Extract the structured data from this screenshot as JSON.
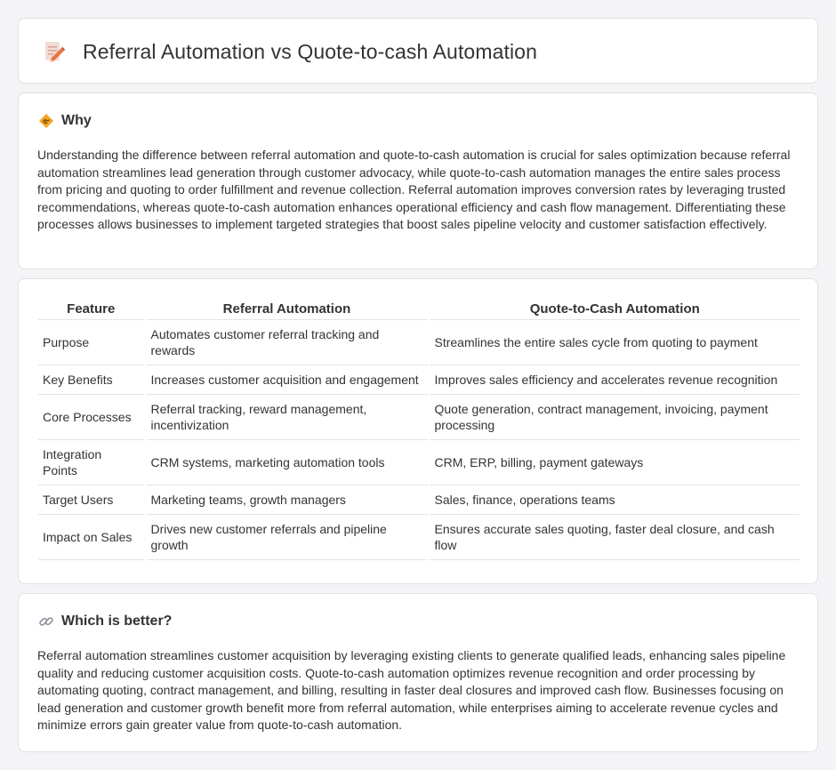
{
  "header": {
    "title": "Referral Automation vs Quote-to-cash Automation",
    "icon": "edit-document-icon"
  },
  "why": {
    "title": "Why",
    "icon": "handshake-diamond-icon",
    "text": "Understanding the difference between referral automation and quote-to-cash automation is crucial for sales optimization because referral automation streamlines lead generation through customer advocacy, while quote-to-cash automation manages the entire sales process from pricing and quoting to order fulfillment and revenue collection. Referral automation improves conversion rates by leveraging trusted recommendations, whereas quote-to-cash automation enhances operational efficiency and cash flow management. Differentiating these processes allows businesses to implement targeted strategies that boost sales pipeline velocity and customer satisfaction effectively."
  },
  "table": {
    "headers": [
      "Feature",
      "Referral Automation",
      "Quote-to-Cash Automation"
    ],
    "rows": [
      [
        "Purpose",
        "Automates customer referral tracking and rewards",
        "Streamlines the entire sales cycle from quoting to payment"
      ],
      [
        "Key Benefits",
        "Increases customer acquisition and engagement",
        "Improves sales efficiency and accelerates revenue recognition"
      ],
      [
        "Core Processes",
        "Referral tracking, reward management, incentivization",
        "Quote generation, contract management, invoicing, payment processing"
      ],
      [
        "Integration Points",
        "CRM systems, marketing automation tools",
        "CRM, ERP, billing, payment gateways"
      ],
      [
        "Target Users",
        "Marketing teams, growth managers",
        "Sales, finance, operations teams"
      ],
      [
        "Impact on Sales",
        "Drives new customer referrals and pipeline growth",
        "Ensures accurate sales quoting, faster deal closure, and cash flow"
      ]
    ]
  },
  "better": {
    "title": "Which is better?",
    "icon": "link-icon",
    "text": "Referral automation streamlines customer acquisition by leveraging existing clients to generate qualified leads, enhancing sales pipeline quality and reducing customer acquisition costs. Quote-to-cash automation optimizes revenue recognition and order processing by automating quoting, contract management, and billing, resulting in faster deal closures and improved cash flow. Businesses focusing on lead generation and customer growth benefit more from referral automation, while enterprises aiming to accelerate revenue cycles and minimize errors gain greater value from quote-to-cash automation."
  }
}
